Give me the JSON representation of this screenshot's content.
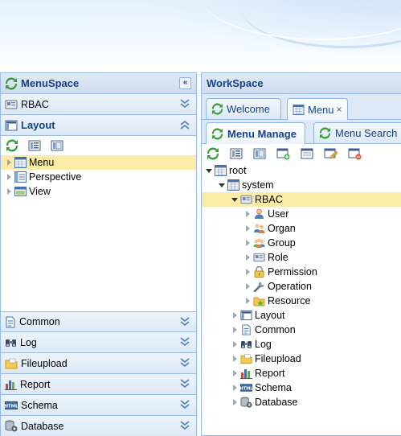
{
  "left_panel": {
    "title": "MenuSpace",
    "collapse_symbol": "«",
    "accordion_top": [
      {
        "label": "RBAC",
        "icon": "card-icon",
        "expanded": false
      },
      {
        "label": "Layout",
        "icon": "layout-icon",
        "expanded": true
      }
    ],
    "tree": [
      {
        "label": "Menu",
        "icon": "menu-grid-icon",
        "selected": true
      },
      {
        "label": "Perspective",
        "icon": "perspective-icon",
        "selected": false
      },
      {
        "label": "View",
        "icon": "view-icon",
        "selected": false
      }
    ],
    "accordion_bottom": [
      {
        "label": "Common",
        "icon": "document-icon"
      },
      {
        "label": "Log",
        "icon": "binoculars-icon"
      },
      {
        "label": "Fileupload",
        "icon": "folder-icon"
      },
      {
        "label": "Report",
        "icon": "chart-icon"
      },
      {
        "label": "Schema",
        "icon": "html-icon"
      },
      {
        "label": "Database",
        "icon": "database-gear-icon"
      }
    ]
  },
  "right_panel": {
    "title": "WorkSpace",
    "tabs": [
      {
        "label": "Welcome",
        "active": false
      },
      {
        "label": "Menu",
        "active": true,
        "close": "×"
      }
    ],
    "subtabs": [
      {
        "label": "Menu Manage",
        "active": true
      },
      {
        "label": "Menu Search",
        "active": false
      }
    ],
    "tree": {
      "root": "root",
      "system": "system",
      "rbac": "RBAC",
      "rbac_children": [
        {
          "label": "User",
          "icon": "user-icon"
        },
        {
          "label": "Organ",
          "icon": "organ-icon"
        },
        {
          "label": "Group",
          "icon": "group-icon"
        },
        {
          "label": "Role",
          "icon": "role-card-icon"
        },
        {
          "label": "Permission",
          "icon": "lock-icon"
        },
        {
          "label": "Operation",
          "icon": "wrench-icon"
        },
        {
          "label": "Resource",
          "icon": "resource-icon"
        }
      ],
      "system_children": [
        {
          "label": "Layout",
          "icon": "layout-icon"
        },
        {
          "label": "Common",
          "icon": "document-icon"
        },
        {
          "label": "Log",
          "icon": "binoculars-icon"
        },
        {
          "label": "Fileupload",
          "icon": "folder-icon"
        },
        {
          "label": "Report",
          "icon": "chart-icon"
        },
        {
          "label": "Schema",
          "icon": "html-icon"
        },
        {
          "label": "Database",
          "icon": "database-gear-icon"
        }
      ]
    }
  },
  "colors": {
    "header_text": "#15428b",
    "border": "#99bbe8",
    "selection": "#fbeba7",
    "refresh_green": "#3a9a3a"
  }
}
